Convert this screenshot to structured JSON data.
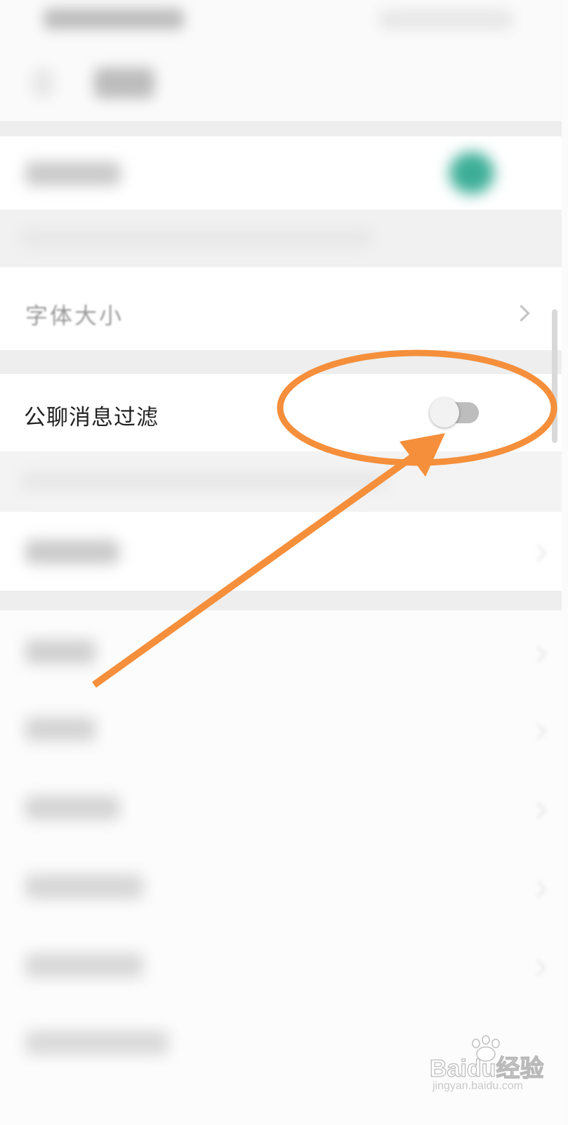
{
  "settings": {
    "public_chat_filter": {
      "label": "公聊消息过滤",
      "enabled": false
    },
    "partial_row_label": "字体大小"
  },
  "watermark": {
    "brand": "Baidu经验",
    "url": "jingyan.baidu.com"
  },
  "colors": {
    "annotation": "#f58f3b",
    "teal_toggle": "#3cae97",
    "toggle_track": "#bdbdbd",
    "toggle_knob": "#f2f2f2"
  }
}
